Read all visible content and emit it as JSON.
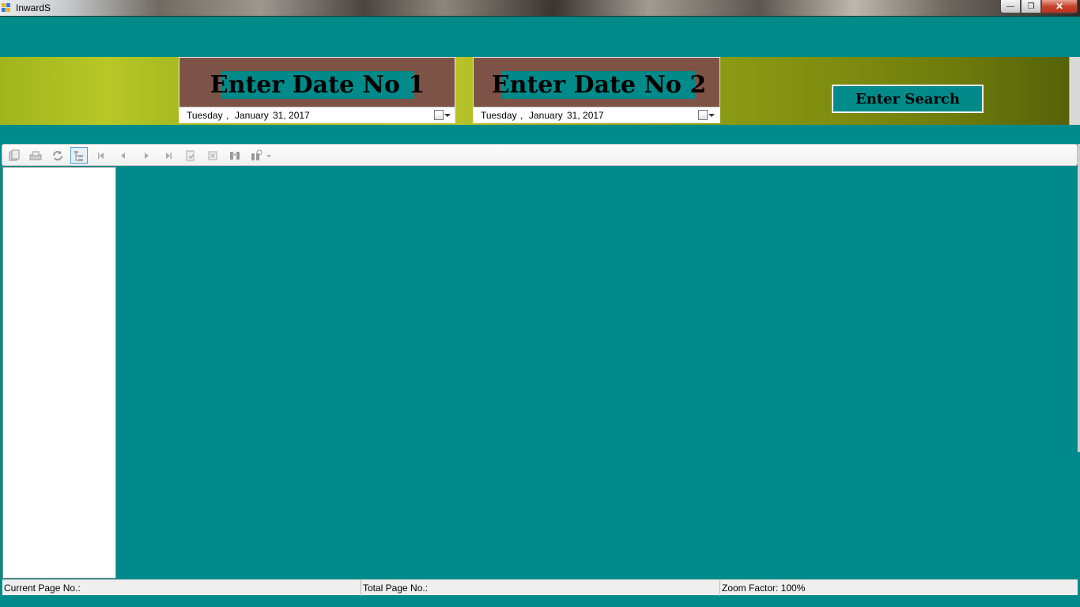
{
  "window": {
    "title": "InwardS",
    "minimize": "—",
    "restore": "❐",
    "close": "✕"
  },
  "date1": {
    "title": "Enter Date No 1",
    "weekday": "Tuesday",
    "sep": ",",
    "month": "January",
    "day_year": "31, 2017"
  },
  "date2": {
    "title": "Enter Date No 2",
    "weekday": "Tuesday",
    "sep": ",",
    "month": "January",
    "day_year": "31, 2017"
  },
  "search": {
    "label": "Enter Search"
  },
  "toolbar": {
    "icons": [
      "export-icon",
      "print-icon",
      "refresh-icon",
      "toggle-group-tree-icon",
      "first-page-icon",
      "previous-page-icon",
      "next-page-icon",
      "last-page-icon",
      "goto-page-icon",
      "close-view-icon",
      "find-icon",
      "zoom-icon"
    ]
  },
  "status": {
    "current_page": "Current Page No.:",
    "total_page": "Total Page No.:",
    "zoom": "Zoom Factor: 100%"
  },
  "colors": {
    "background": "#008b8a",
    "date_panel": "#7e5347",
    "banner": "#a7bb21"
  }
}
